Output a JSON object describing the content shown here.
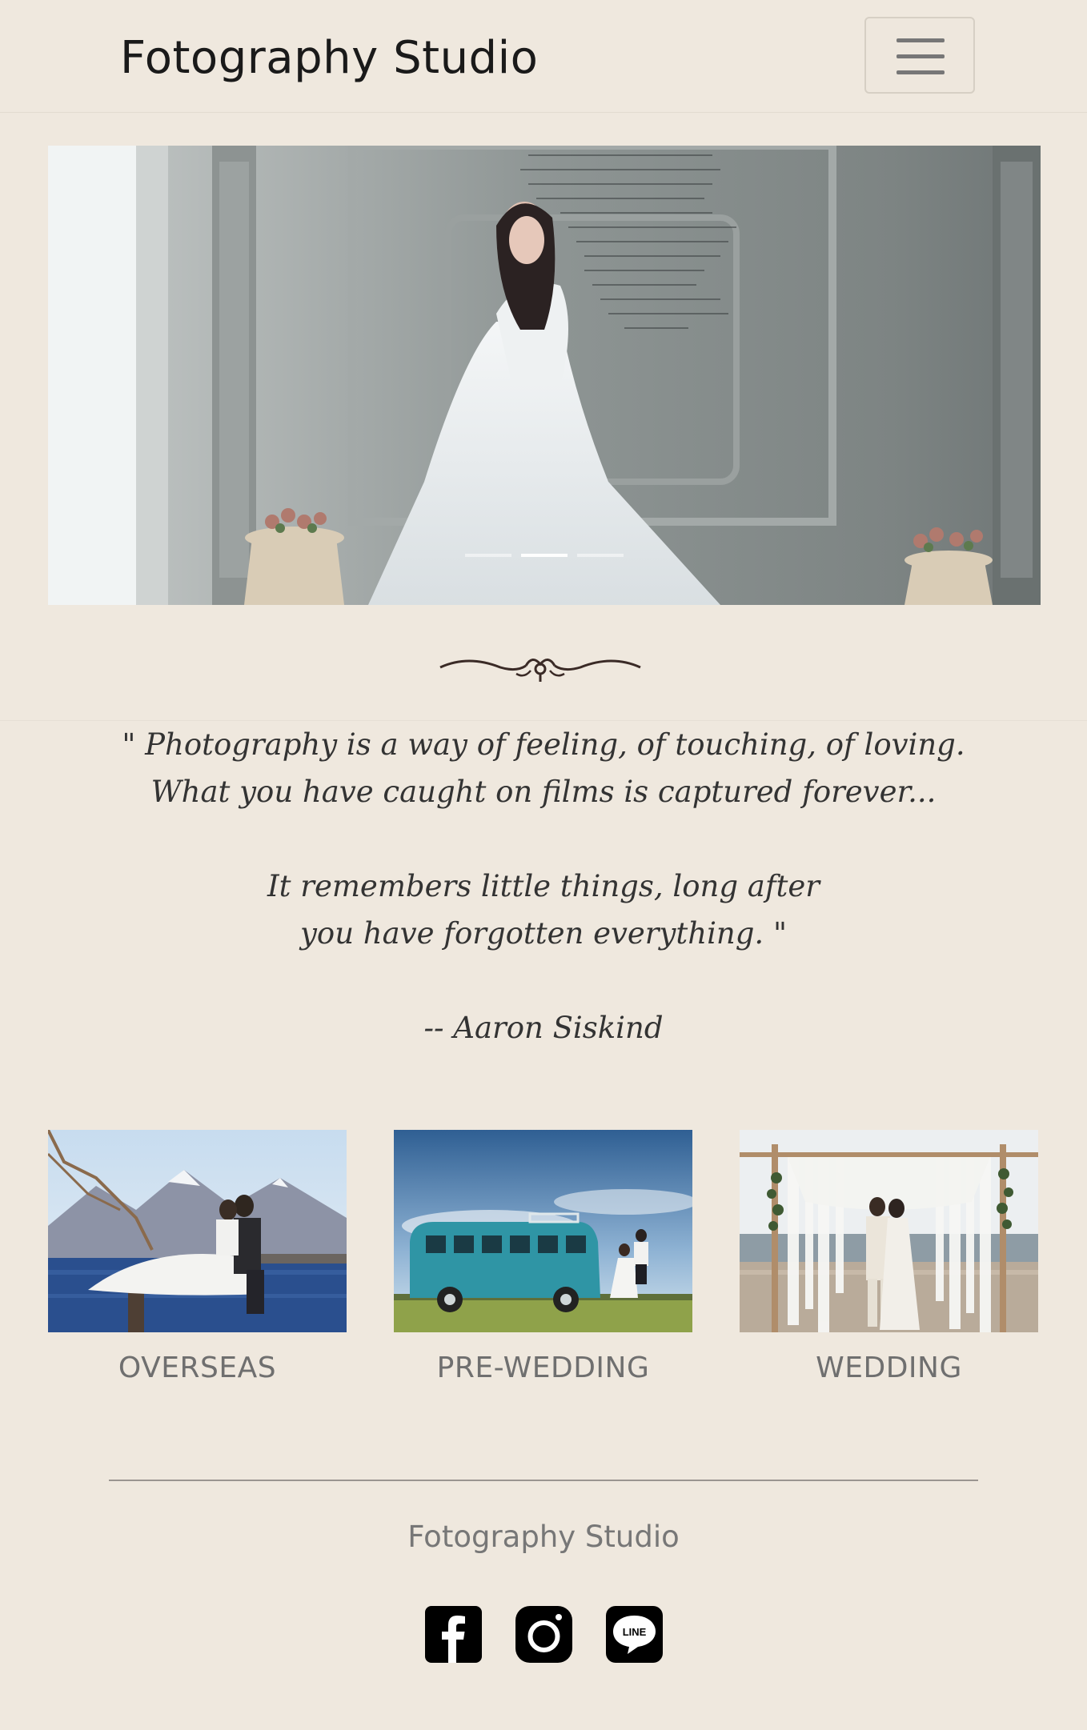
{
  "navbar": {
    "brand": "Fotography Studio",
    "toggle_icon": "hamburger-menu-icon"
  },
  "carousel": {
    "slide_count": 3,
    "active_index": 1
  },
  "quote": {
    "lines": [
      "\" Photography is a way of feeling, of touching, of loving.",
      "What you have caught on films is captured forever...",
      "",
      "It remembers little things, long after",
      "you have forgotten everything. \"",
      "",
      "-- Aaron Siskind"
    ]
  },
  "gallery": [
    {
      "label": "OVERSEAS"
    },
    {
      "label": "PRE-WEDDING"
    },
    {
      "label": "WEDDING"
    }
  ],
  "footer": {
    "brand": "Fotography Studio",
    "social_icons": [
      "facebook-icon",
      "instagram-icon",
      "line-icon"
    ],
    "line_text": "LINE"
  },
  "colors": {
    "background": "#efe8de",
    "brand_text": "#1a1a1a",
    "label_text": "#6f6f6f"
  }
}
